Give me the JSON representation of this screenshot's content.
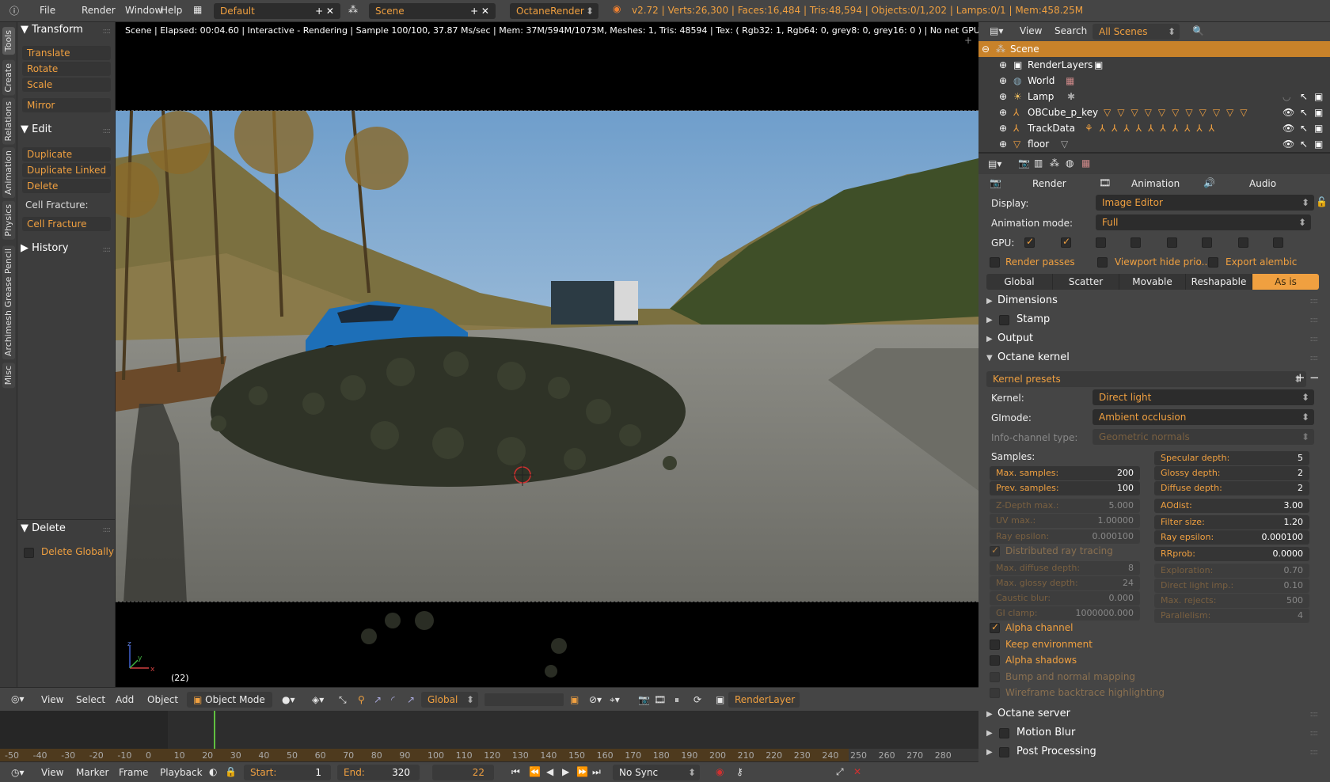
{
  "topbar": {
    "menus": [
      "File",
      "Render",
      "Window",
      "Help"
    ],
    "layout": "Default",
    "scene": "Scene",
    "engine": "OctaneRender",
    "stats": "v2.72 | Verts:26,300 | Faces:16,484 | Tris:48,594 | Objects:0/1,202 | Lamps:0/1 | Mem:458.25M"
  },
  "vtabs": [
    "Tools",
    "Create",
    "Relations",
    "Animation",
    "Physics",
    "Grease Pencil",
    "Archimesh",
    "Misc"
  ],
  "toolshelf": {
    "transform": "Transform",
    "translate": "Translate",
    "rotate": "Rotate",
    "scale": "Scale",
    "mirror": "Mirror",
    "edit": "Edit",
    "duplicate": "Duplicate",
    "duplicate_linked": "Duplicate Linked",
    "delete": "Delete",
    "cell_fracture_label": "Cell Fracture:",
    "cell_fracture": "Cell Fracture",
    "history": "History",
    "delete_panel": "Delete",
    "delete_globally": "Delete Globally"
  },
  "viewport": {
    "render_info": "Scene | Elapsed: 00:04.60 | Interactive - Rendering | Sample 100/100, 37.87 Ms/sec | Mem: 37M/594M/1073M, Meshes: 1, Tris: 48594 | Tex: ( Rgb32: 1, Rgb64: 0, grey8: 0, grey16: 0 ) | No net GPUs",
    "frame_label": "(22)",
    "axis_x": "x",
    "axis_y": "y",
    "axis_z": "z"
  },
  "vp_header": {
    "view": "View",
    "select": "Select",
    "add": "Add",
    "object": "Object",
    "mode": "Object Mode",
    "orientation": "Global",
    "render_layer": "RenderLayer"
  },
  "timeline": {
    "ticks": [
      "-50",
      "-40",
      "-30",
      "-20",
      "-10",
      "0",
      "10",
      "20",
      "30",
      "40",
      "50",
      "60",
      "70",
      "80",
      "90",
      "100",
      "110",
      "120",
      "130",
      "140",
      "150",
      "160",
      "170",
      "180",
      "190",
      "200",
      "210",
      "220",
      "230",
      "240",
      "250",
      "260",
      "270",
      "280"
    ],
    "current_frame_fraction": 0.5,
    "view": "View",
    "marker": "Marker",
    "frame": "Frame",
    "playback": "Playback",
    "start_label": "Start:",
    "start": "1",
    "end_label": "End:",
    "end": "320",
    "current": "22",
    "sync": "No Sync"
  },
  "outliner": {
    "view": "View",
    "search": "Search",
    "filter": "All Scenes",
    "rows": [
      "Scene",
      "RenderLayers",
      "World",
      "Lamp",
      "OBCube_p_key",
      "TrackData",
      "floor"
    ]
  },
  "props": {
    "render_btn": "Render",
    "animation_btn": "Animation",
    "audio_btn": "Audio",
    "display_label": "Display:",
    "display": "Image Editor",
    "anim_mode_label": "Animation mode:",
    "anim_mode": "Full",
    "gpu_label": "GPU:",
    "render_passes": "Render passes",
    "viewport_hide": "Viewport hide prio...",
    "export_alembic": "Export alembic",
    "segments": [
      "Global",
      "Scatter",
      "Movable",
      "Reshapable",
      "As is"
    ],
    "dimensions": "Dimensions",
    "stamp": "Stamp",
    "output": "Output",
    "octane_kernel": "Octane kernel",
    "kernel_presets": "Kernel presets",
    "kernel_label": "Kernel:",
    "kernel": "Direct light",
    "gimode_label": "GImode:",
    "gimode": "Ambient occlusion",
    "info_channel_label": "Info-channel type:",
    "info_channel": "Geometric normals",
    "samples_label": "Samples:",
    "left_nums": [
      {
        "l": "Max. samples:",
        "v": "200",
        "dim": false
      },
      {
        "l": "Prev. samples:",
        "v": "100",
        "dim": false
      },
      {
        "l": "Z-Depth max.:",
        "v": "5.000",
        "dim": true
      },
      {
        "l": "UV max.:",
        "v": "1.00000",
        "dim": true
      },
      {
        "l": "Ray epsilon:",
        "v": "0.000100",
        "dim": true
      }
    ],
    "right_nums": [
      {
        "l": "Specular depth:",
        "v": "5",
        "dim": false
      },
      {
        "l": "Glossy depth:",
        "v": "2",
        "dim": false
      },
      {
        "l": "Diffuse depth:",
        "v": "2",
        "dim": false
      },
      {
        "l": "AOdist:",
        "v": "3.00",
        "dim": false
      },
      {
        "l": "Filter size:",
        "v": "1.20",
        "dim": false
      },
      {
        "l": "Ray epsilon:",
        "v": "0.000100",
        "dim": false
      }
    ],
    "distributed": "Distributed ray tracing",
    "rrprob_label": "RRprob:",
    "rrprob": "0.0000",
    "left_nums2": [
      {
        "l": "Max. diffuse depth:",
        "v": "8"
      },
      {
        "l": "Max. glossy depth:",
        "v": "24"
      },
      {
        "l": "Caustic blur:",
        "v": "0.000"
      },
      {
        "l": "GI clamp:",
        "v": "1000000.000"
      }
    ],
    "right_nums2": [
      {
        "l": "Exploration:",
        "v": "0.70"
      },
      {
        "l": "Direct light imp.:",
        "v": "0.10"
      },
      {
        "l": "Max. rejects:",
        "v": "500"
      },
      {
        "l": "Parallelism:",
        "v": "4"
      }
    ],
    "alpha_channel": "Alpha channel",
    "keep_env": "Keep environment",
    "alpha_shadows": "Alpha shadows",
    "bump": "Bump and normal mapping",
    "wireframe": "Wireframe backtrace highlighting",
    "octane_server": "Octane server",
    "motion_blur": "Motion Blur",
    "post_processing": "Post Processing"
  }
}
